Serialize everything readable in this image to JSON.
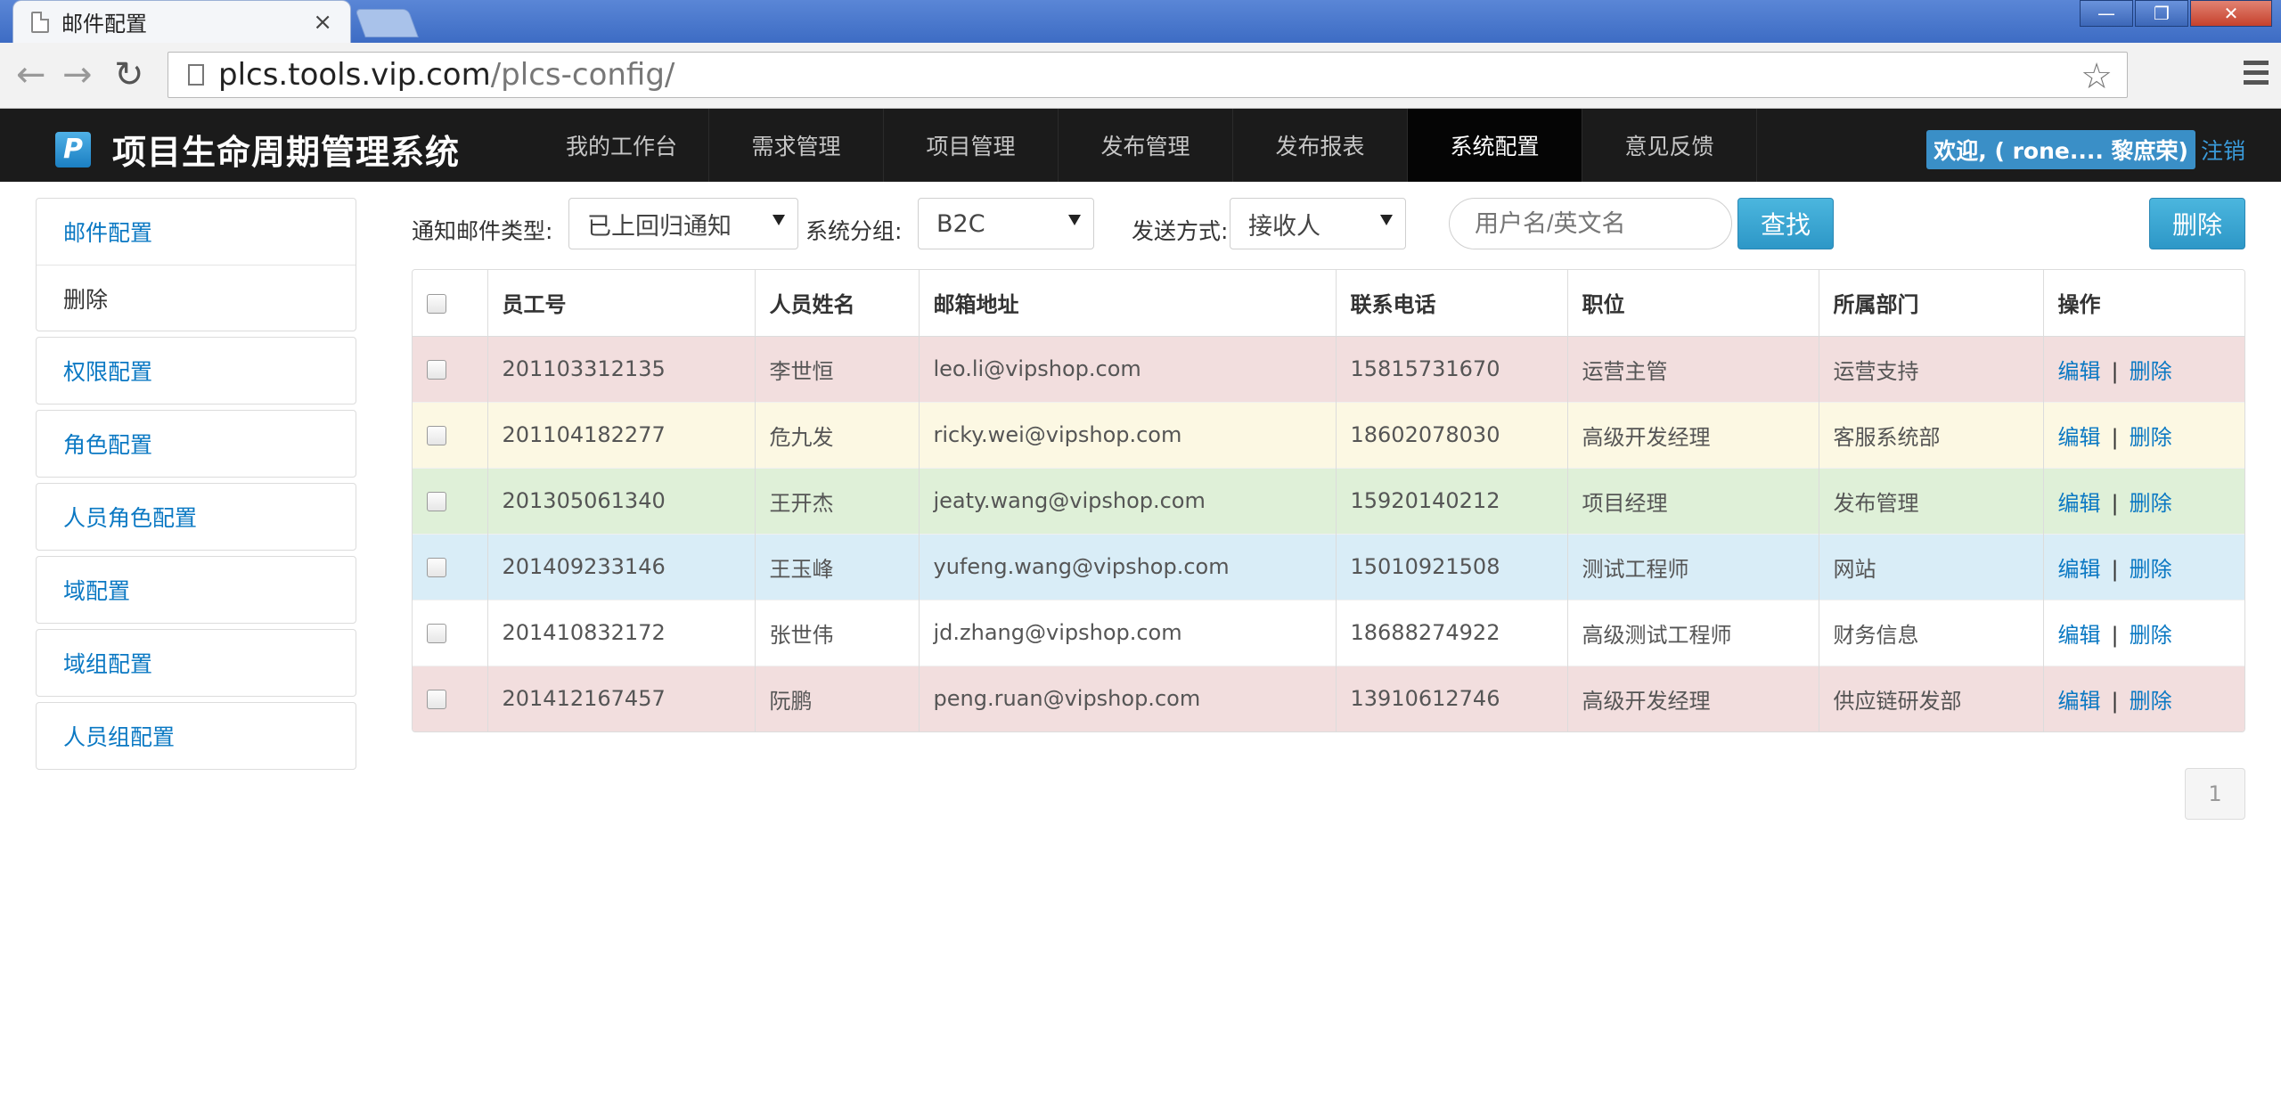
{
  "browser": {
    "tab_title": "邮件配置",
    "tab_close": "×",
    "url_host": "plcs.tools.vip.com",
    "url_path": "/plcs-config/",
    "win_min": "—",
    "win_restore": "❐",
    "win_close": "✕"
  },
  "header": {
    "logo_letter": "P",
    "app_title": "项目生命周期管理系统",
    "nav": [
      "我的工作台",
      "需求管理",
      "项目管理",
      "发布管理",
      "发布报表",
      "系统配置",
      "意见反馈"
    ],
    "active_nav": "系统配置",
    "welcome": "欢迎, ( rone.... 黎庶荣)",
    "logout": "注销"
  },
  "sidebar": {
    "items": [
      {
        "label": "邮件配置",
        "sub": "删除"
      },
      {
        "label": "权限配置"
      },
      {
        "label": "角色配置"
      },
      {
        "label": "人员角色配置"
      },
      {
        "label": "域配置"
      },
      {
        "label": "域组配置"
      },
      {
        "label": "人员组配置"
      }
    ]
  },
  "filters": {
    "type_label": "通知邮件类型:",
    "type_value": "已上回归通知",
    "group_label": "系统分组:",
    "group_value": "B2C",
    "send_label": "发送方式:",
    "send_value": "接收人",
    "search_placeholder": "用户名/英文名",
    "search_button": "查找",
    "delete_button": "删除"
  },
  "table": {
    "headers": [
      "员工号",
      "人员姓名",
      "邮箱地址",
      "联系电话",
      "职位",
      "所属部门",
      "操作"
    ],
    "edit_label": "编辑",
    "delete_label": "删除",
    "separator": "|",
    "rows": [
      {
        "id": "201103312135",
        "name": "李世恒",
        "email": "leo.li@vipshop.com",
        "phone": "15815731670",
        "title": "运营主管",
        "dept": "运营支持",
        "style": "danger"
      },
      {
        "id": "201104182277",
        "name": "危九发",
        "email": "ricky.wei@vipshop.com",
        "phone": "18602078030",
        "title": "高级开发经理",
        "dept": "客服系统部",
        "style": "warning"
      },
      {
        "id": "201305061340",
        "name": "王开杰",
        "email": "jeaty.wang@vipshop.com",
        "phone": "15920140212",
        "title": "项目经理",
        "dept": "发布管理",
        "style": "success"
      },
      {
        "id": "201409233146",
        "name": "王玉峰",
        "email": "yufeng.wang@vipshop.com",
        "phone": "15010921508",
        "title": "测试工程师",
        "dept": "网站",
        "style": "info"
      },
      {
        "id": "201410832172",
        "name": "张世伟",
        "email": "jd.zhang@vipshop.com",
        "phone": "18688274922",
        "title": "高级测试工程师",
        "dept": "财务信息",
        "style": "plain"
      },
      {
        "id": "201412167457",
        "name": "阮鹏",
        "email": "peng.ruan@vipshop.com",
        "phone": "13910612746",
        "title": "高级开发经理",
        "dept": "供应链研发部",
        "style": "danger"
      }
    ]
  },
  "pagination": {
    "current": "1"
  }
}
